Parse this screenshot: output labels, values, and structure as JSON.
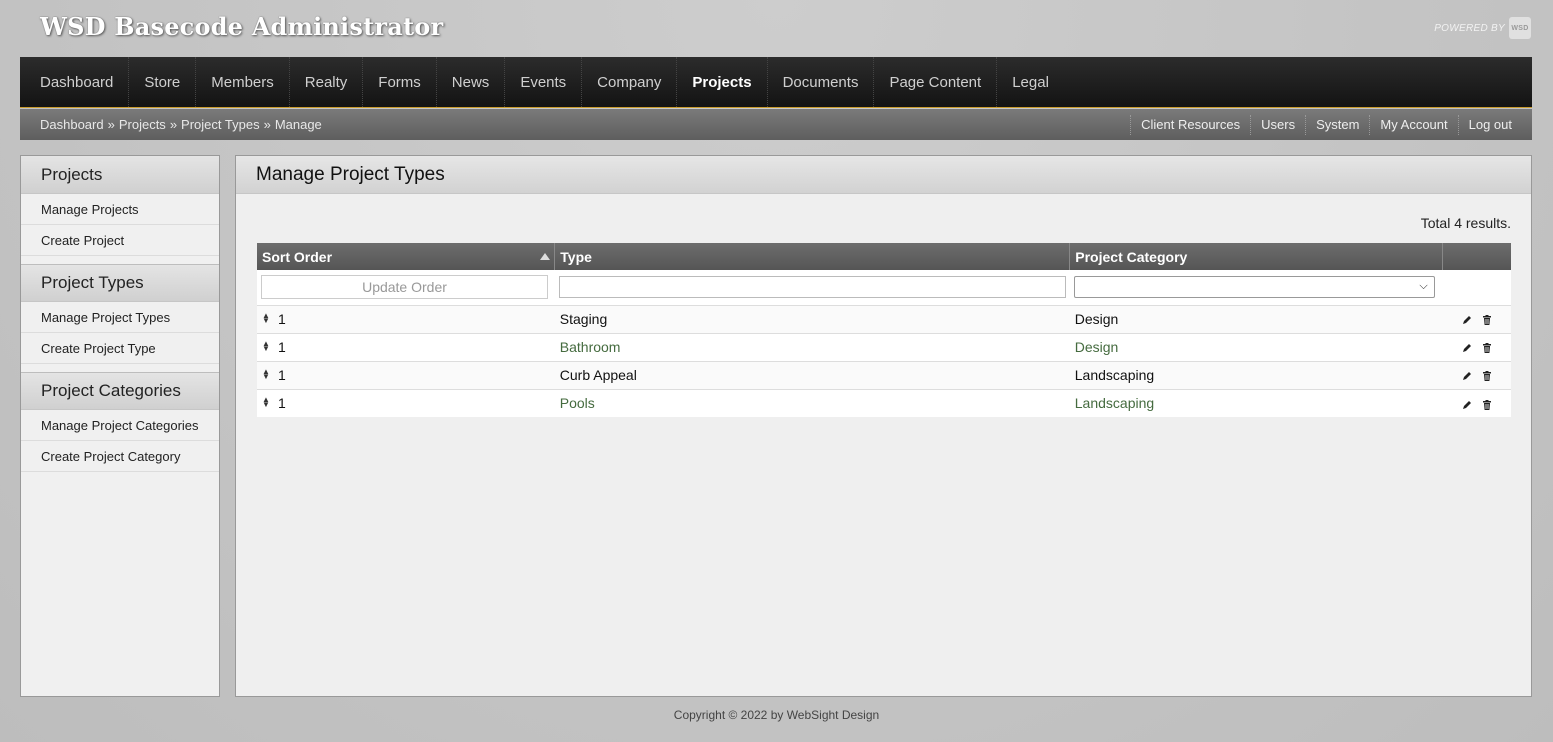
{
  "app": {
    "title": "WSD Basecode Administrator",
    "powered_by": "POWERED BY",
    "powered_logo": "WSD"
  },
  "nav": {
    "items": [
      {
        "label": "Dashboard",
        "active": false
      },
      {
        "label": "Store",
        "active": false
      },
      {
        "label": "Members",
        "active": false
      },
      {
        "label": "Realty",
        "active": false
      },
      {
        "label": "Forms",
        "active": false
      },
      {
        "label": "News",
        "active": false
      },
      {
        "label": "Events",
        "active": false
      },
      {
        "label": "Company",
        "active": false
      },
      {
        "label": "Projects",
        "active": true
      },
      {
        "label": "Documents",
        "active": false
      },
      {
        "label": "Page Content",
        "active": false
      },
      {
        "label": "Legal",
        "active": false
      }
    ]
  },
  "breadcrumb": {
    "items": [
      "Dashboard",
      "Projects",
      "Project Types",
      "Manage"
    ],
    "separator": "»"
  },
  "util_nav": {
    "items": [
      "Client Resources",
      "Users",
      "System",
      "My Account",
      "Log out"
    ]
  },
  "sidebar": {
    "groups": [
      {
        "title": "Projects",
        "links": [
          "Manage Projects",
          "Create Project"
        ]
      },
      {
        "title": "Project Types",
        "links": [
          "Manage Project Types",
          "Create Project Type"
        ]
      },
      {
        "title": "Project Categories",
        "links": [
          "Manage Project Categories",
          "Create Project Category"
        ]
      }
    ]
  },
  "main": {
    "title": "Manage Project Types",
    "total_text": "Total 4 results.",
    "columns": [
      "Sort Order",
      "Type",
      "Project Category",
      ""
    ],
    "update_order_label": "Update Order",
    "type_filter_value": "",
    "category_filter_value": "",
    "rows": [
      {
        "sort": "1",
        "type": "Staging",
        "category": "Design"
      },
      {
        "sort": "1",
        "type": "Bathroom",
        "category": "Design"
      },
      {
        "sort": "1",
        "type": "Curb Appeal",
        "category": "Landscaping"
      },
      {
        "sort": "1",
        "type": "Pools",
        "category": "Landscaping"
      }
    ]
  },
  "footer": {
    "text": "Copyright © 2022 by WebSight Design"
  },
  "colors": {
    "accent": "#c89b2c",
    "link_green": "#456b3f"
  }
}
